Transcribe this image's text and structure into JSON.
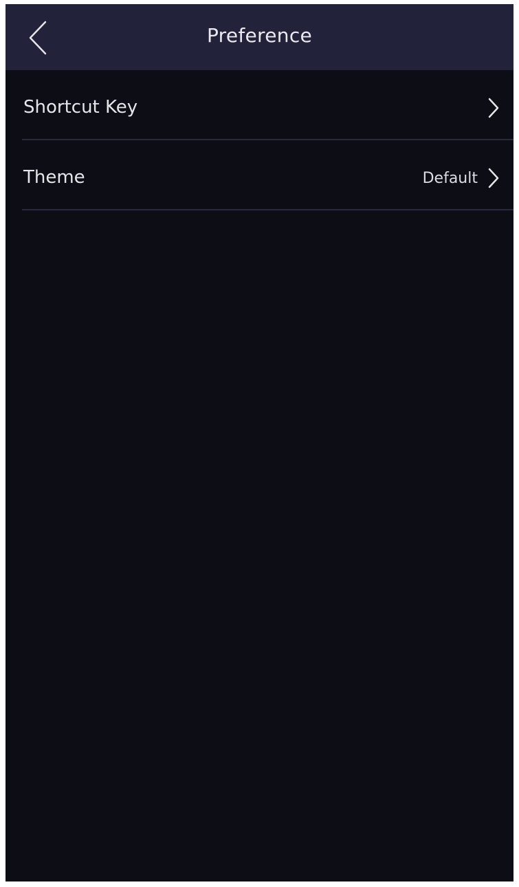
{
  "header": {
    "title": "Preference",
    "back_icon": "chevron-left-icon"
  },
  "rows": [
    {
      "label": "Shortcut Key",
      "value": "",
      "icon": "chevron-right-icon"
    },
    {
      "label": "Theme",
      "value": "Default",
      "icon": "chevron-right-icon"
    }
  ],
  "colors": {
    "header_background": "#22223a",
    "page_background": "#0d0d15",
    "text": "#e6e6ea",
    "divider": "#2a2a3a"
  }
}
